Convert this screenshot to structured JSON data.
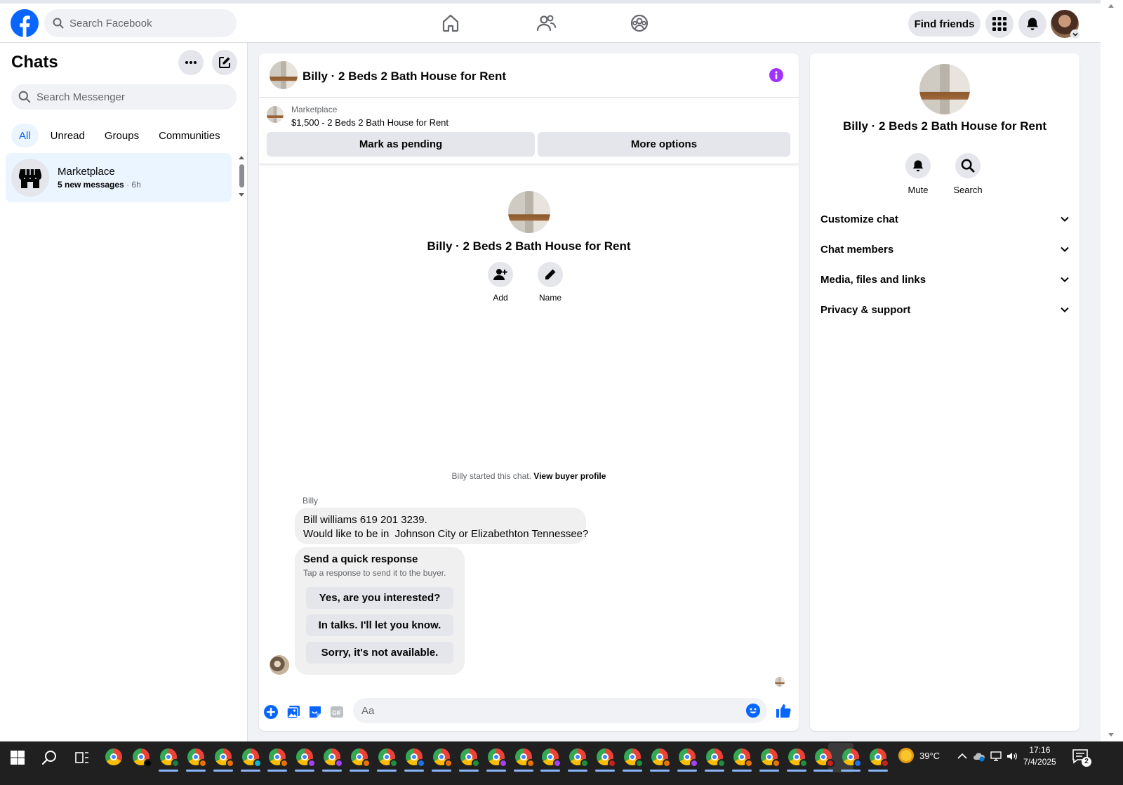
{
  "topbar": {
    "search_placeholder": "Search Facebook",
    "find_friends": "Find friends",
    "nav": [
      "home-icon",
      "friends-icon",
      "groups-icon"
    ]
  },
  "sidebar": {
    "title": "Chats",
    "search_placeholder": "Search Messenger",
    "tabs": [
      {
        "label": "All",
        "active": true
      },
      {
        "label": "Unread",
        "active": false
      },
      {
        "label": "Groups",
        "active": false
      },
      {
        "label": "Communities",
        "active": false
      }
    ],
    "chat": {
      "name": "Marketplace",
      "new_messages": "5 new messages",
      "separator": " · ",
      "time": "6h"
    }
  },
  "chat": {
    "title": "Billy · 2 Beds 2 Bath House for Rent",
    "listing": {
      "source": "Marketplace",
      "price_title": "$1,500 - 2 Beds 2 Bath House for Rent",
      "mark_pending": "Mark as pending",
      "more_options": "More options"
    },
    "intro": {
      "name": "Billy · 2 Beds 2 Bath House for Rent",
      "add_label": "Add",
      "name_label": "Name"
    },
    "started_text": "Billy started this chat.",
    "view_profile": "View buyer profile",
    "sender": "Billy",
    "message_line1": "Bill williams 619 201 3239.",
    "message_line2": "Would like to be in  Johnson City or Elizabethton Tennessee?",
    "quick": {
      "title": "Send a quick response",
      "subtitle": "Tap a response to send it to the buyer.",
      "options": [
        "Yes, are you interested?",
        "In talks. I'll let you know.",
        "Sorry, it's not available."
      ]
    },
    "composer_placeholder": "Aa"
  },
  "details": {
    "name": "Billy · 2 Beds 2 Bath House for Rent",
    "mute": "Mute",
    "search": "Search",
    "sections": [
      "Customize chat",
      "Chat members",
      "Media, files and links",
      "Privacy & support"
    ]
  },
  "taskbar": {
    "temperature": "39°C",
    "time": "17:16",
    "date": "7/4/2025",
    "notifications": "2"
  },
  "colors": {
    "facebook_blue": "#0866ff",
    "selected_bg": "#ebf5ff",
    "info_purple": "#a033ff"
  }
}
